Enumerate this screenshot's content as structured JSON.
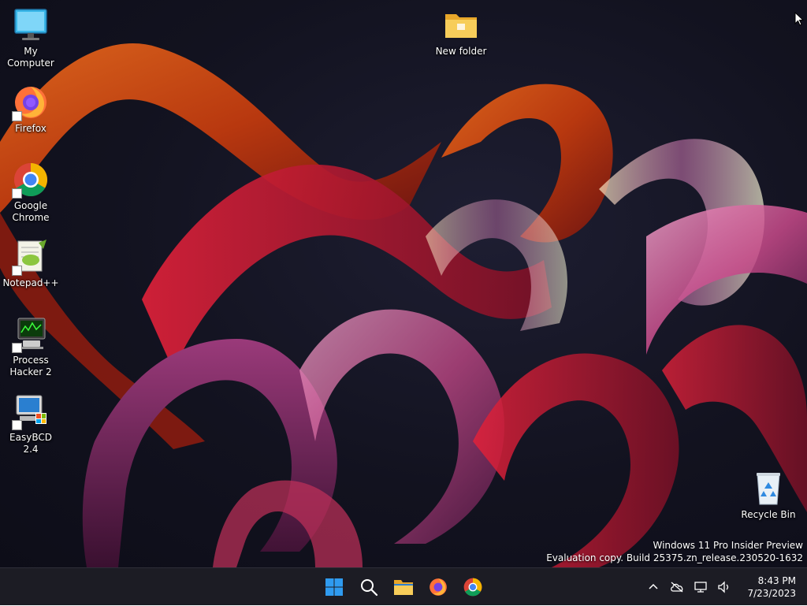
{
  "desktop": {
    "icons": [
      {
        "label": "My Computer",
        "icon": "monitor-icon"
      },
      {
        "label": "New folder",
        "icon": "folder-icon"
      },
      {
        "label": "Firefox",
        "icon": "firefox-icon"
      },
      {
        "label": "Google Chrome",
        "icon": "chrome-icon"
      },
      {
        "label": "Notepad++",
        "icon": "notepad-plus-plus-icon"
      },
      {
        "label": "Process Hacker 2",
        "icon": "process-hacker-icon"
      },
      {
        "label": "EasyBCD 2.4",
        "icon": "easybcd-icon"
      },
      {
        "label": "Recycle Bin",
        "icon": "recycle-bin-icon"
      }
    ],
    "watermark": {
      "line1": "Windows 11 Pro Insider Preview",
      "line2": "Evaluation copy. Build 25375.zn_release.230520-1632"
    }
  },
  "taskbar": {
    "pinned": [
      {
        "name": "Start",
        "icon": "windows-logo-icon"
      },
      {
        "name": "Search",
        "icon": "search-icon"
      },
      {
        "name": "File Explorer",
        "icon": "folder-icon"
      },
      {
        "name": "Firefox",
        "icon": "firefox-icon"
      },
      {
        "name": "Google Chrome",
        "icon": "chrome-icon"
      }
    ],
    "tray": {
      "icons": [
        "chevron-up-icon",
        "cloud-offline-icon",
        "network-icon",
        "volume-icon"
      ],
      "time": "8:43 PM",
      "date": "7/23/2023"
    }
  },
  "colors": {
    "taskbar_bg": "#1c1c24",
    "start_blue": "#2f9bf0",
    "folder_yellow": "#f5c542"
  }
}
